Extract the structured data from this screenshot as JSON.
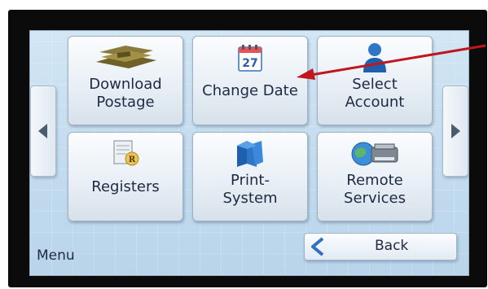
{
  "tiles": [
    {
      "label": "Download\nPostage",
      "icon": "postage-money-icon"
    },
    {
      "label": "Change Date",
      "icon": "calendar-icon",
      "calendar_day": "27"
    },
    {
      "label": "Select\nAccount",
      "icon": "person-icon"
    },
    {
      "label": "Registers",
      "icon": "register-document-icon",
      "register_mark": "R"
    },
    {
      "label": "Print-\nSystem",
      "icon": "print-system-icon"
    },
    {
      "label": "Remote\nServices",
      "icon": "remote-services-icon"
    }
  ],
  "footer": {
    "menu_label": "Menu",
    "back_label": "Back"
  },
  "annotation": {
    "arrow_color": "#c0161d"
  },
  "colors": {
    "screen_bg": "#c3dbee",
    "text": "#1e2a44"
  }
}
